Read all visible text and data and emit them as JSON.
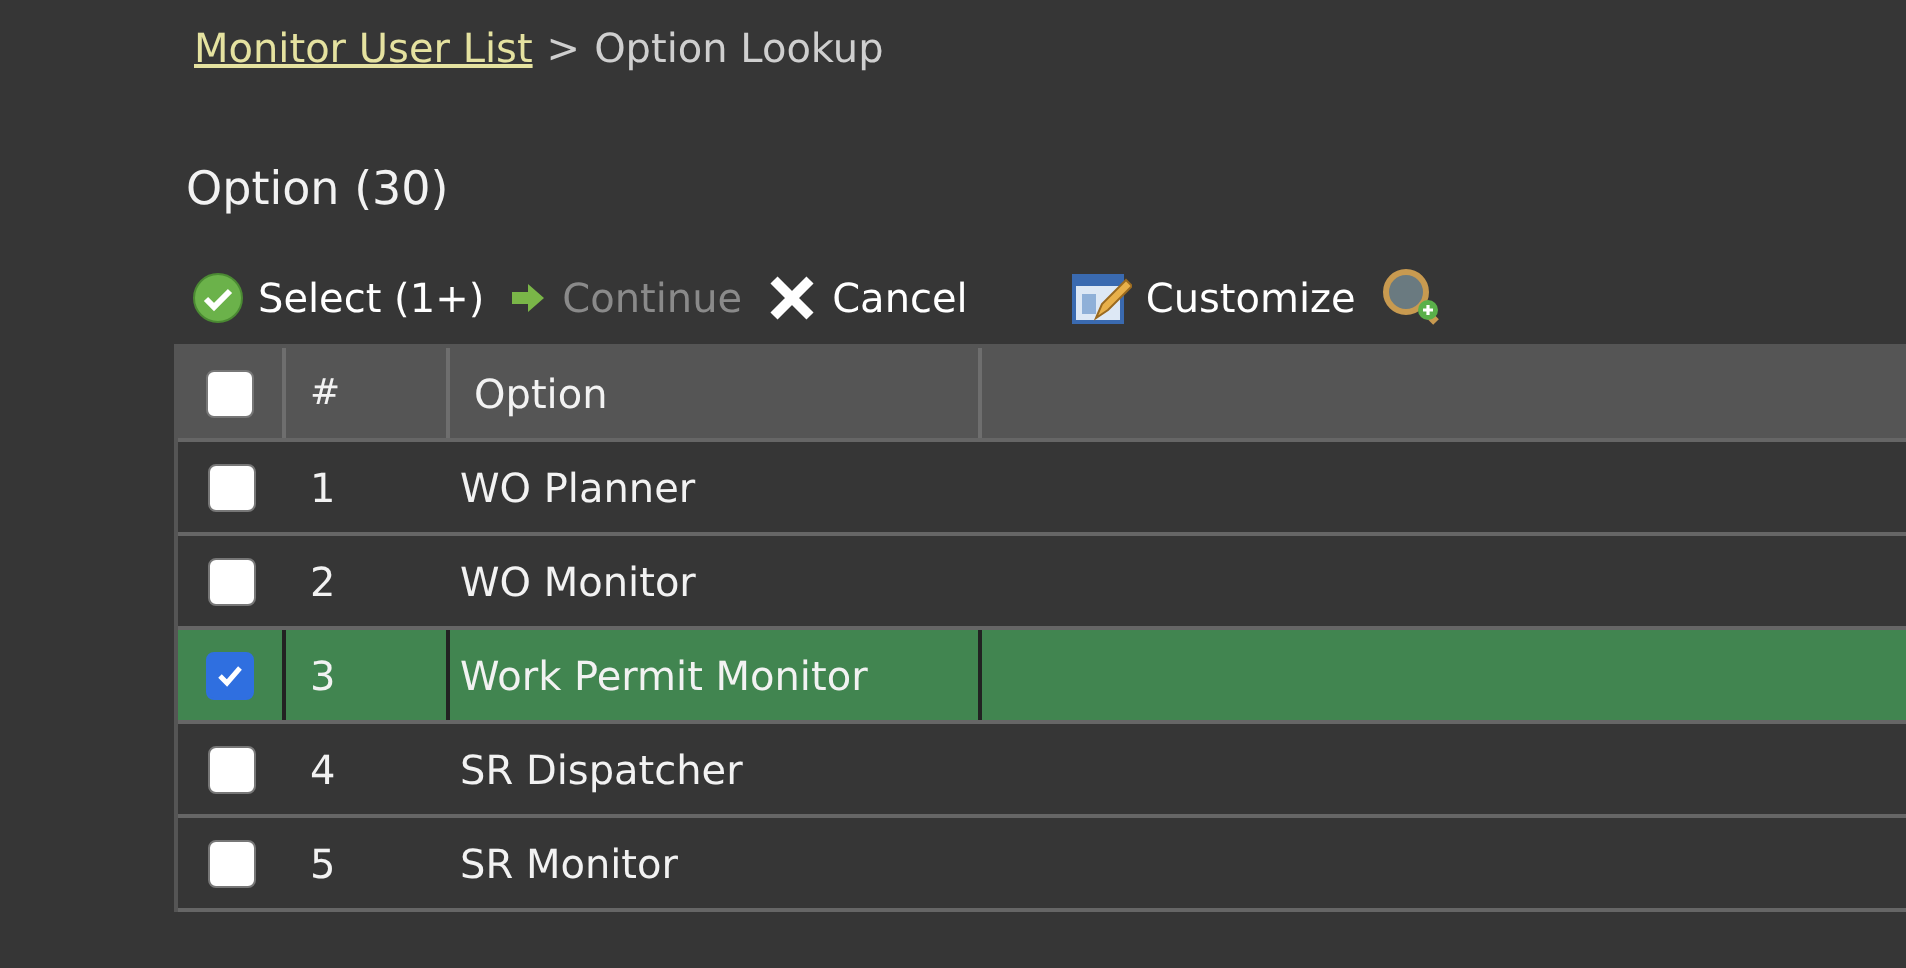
{
  "breadcrumb": {
    "link": "Monitor User List",
    "separator": ">",
    "current": "Option Lookup"
  },
  "title": "Option (30)",
  "toolbar": [
    {
      "kind": "select",
      "label": "Select (1+)",
      "disabled": false
    },
    {
      "kind": "continue",
      "label": "Continue",
      "disabled": true
    },
    {
      "kind": "cancel",
      "label": "Cancel",
      "disabled": false
    },
    {
      "kind": "customize",
      "label": "Customize",
      "disabled": false
    },
    {
      "kind": "search"
    }
  ],
  "table": {
    "header_checked": false,
    "columns": [
      "#",
      "Option"
    ],
    "rows": [
      {
        "number": "1",
        "option": "WO Planner",
        "selected": false
      },
      {
        "number": "2",
        "option": "WO Monitor",
        "selected": false
      },
      {
        "number": "3",
        "option": "Work Permit Monitor",
        "selected": true
      },
      {
        "number": "4",
        "option": "SR Dispatcher",
        "selected": false
      },
      {
        "number": "5",
        "option": "SR Monitor",
        "selected": false
      }
    ]
  }
}
